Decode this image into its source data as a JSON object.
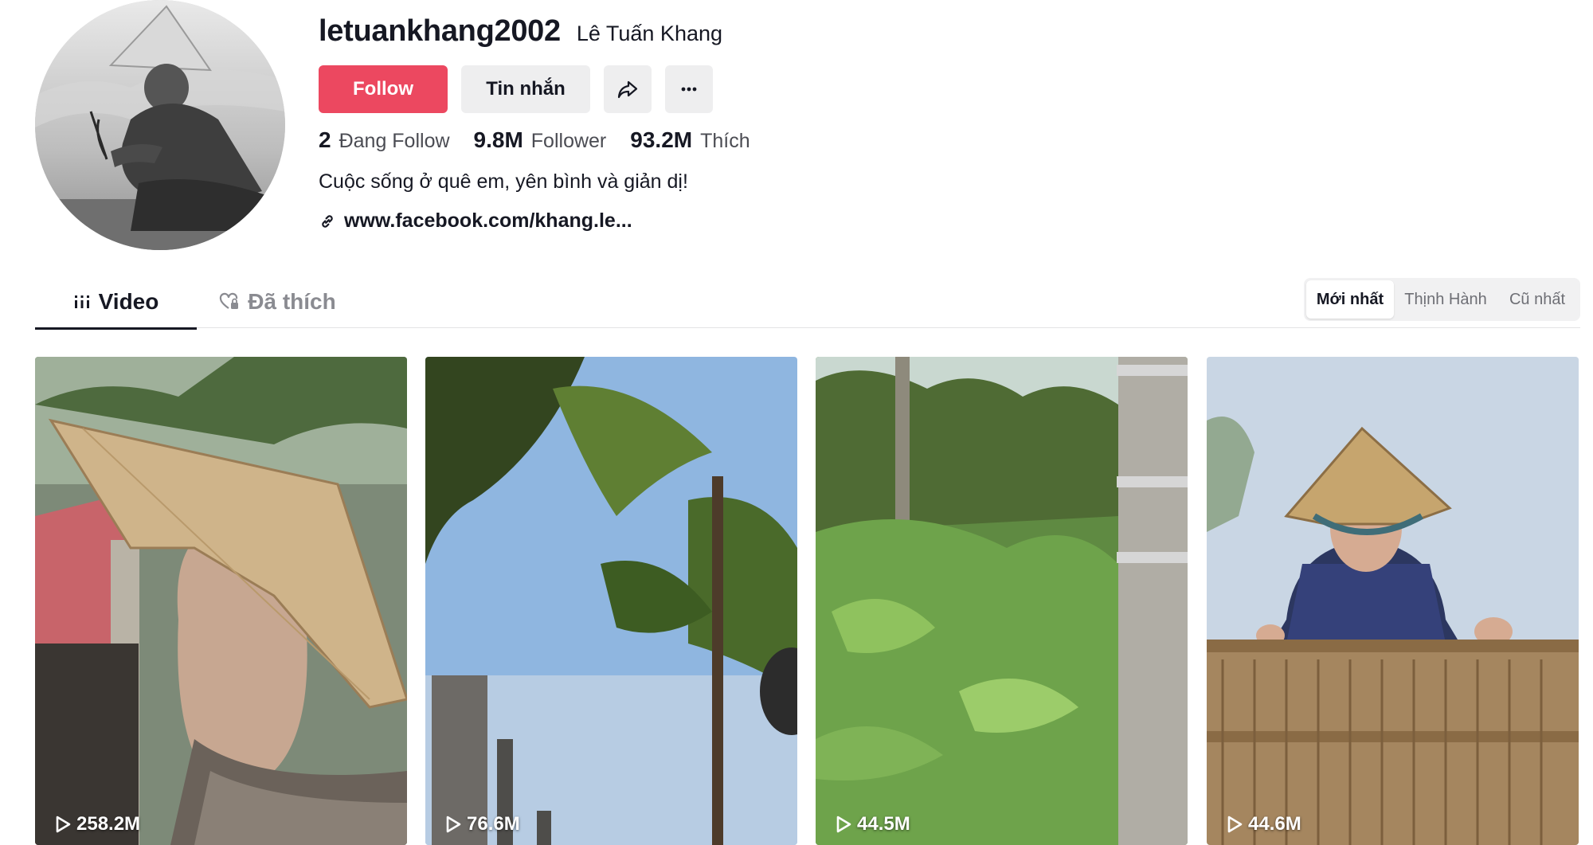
{
  "profile": {
    "username": "letuankhang2002",
    "nickname": "Lê Tuấn Khang",
    "bio": "Cuộc sống ở quê em, yên bình và giản dị!",
    "link": "www.facebook.com/khang.le...",
    "avatar_icon": "profile-photo"
  },
  "actions": {
    "follow_label": "Follow",
    "message_label": "Tin nhắn",
    "share_icon": "share-icon",
    "more_icon": "more-icon"
  },
  "stats": [
    {
      "value": "2",
      "label": "Đang Follow"
    },
    {
      "value": "9.8M",
      "label": "Follower"
    },
    {
      "value": "93.2M",
      "label": "Thích"
    }
  ],
  "tabs": [
    {
      "label": "Video",
      "icon": "grid-icon",
      "active": true
    },
    {
      "label": "Đã thích",
      "icon": "heart-lock-icon",
      "active": false
    }
  ],
  "sort": [
    {
      "label": "Mới nhất",
      "active": true
    },
    {
      "label": "Thịnh Hành",
      "active": false
    },
    {
      "label": "Cũ nhất",
      "active": false
    }
  ],
  "videos": [
    {
      "views": "258.2M"
    },
    {
      "views": "76.6M"
    },
    {
      "views": "44.5M"
    },
    {
      "views": "44.6M"
    }
  ],
  "colors": {
    "accent": "#ec4860",
    "text": "#161823",
    "muted": "#8a8b91",
    "button_bg": "#eeeeef"
  }
}
